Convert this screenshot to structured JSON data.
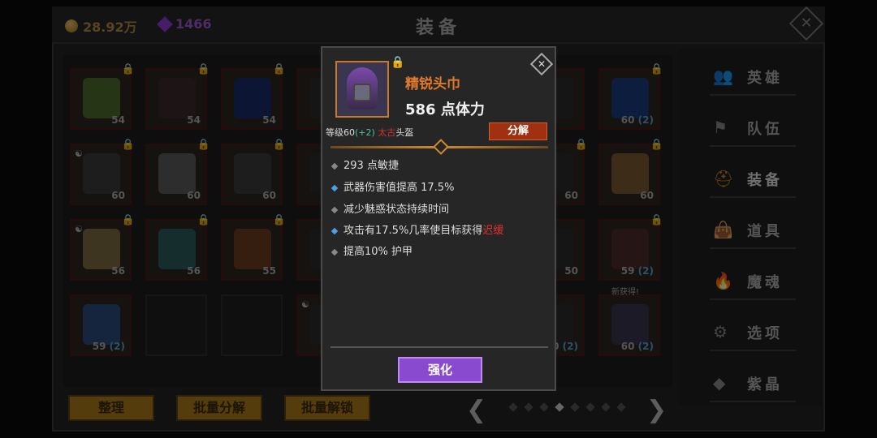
{
  "header": {
    "gold": "28.92万",
    "crystals": "1466",
    "title": "装备",
    "close_symbol": "✕"
  },
  "inventory": [
    {
      "level": "54",
      "locked": true,
      "icon": "spear-icon",
      "color": "#4a6a2a"
    },
    {
      "level": "54",
      "locked": true,
      "icon": "dark-helmet-icon",
      "color": "#3a2a2a"
    },
    {
      "level": "54",
      "locked": true,
      "icon": "blue-boots-icon",
      "color": "#1a2a6a"
    },
    {
      "level": "",
      "locked": true,
      "icon": "hidden-item-icon",
      "color": "#2a2a2a"
    },
    {
      "level": "",
      "locked": false,
      "icon": "hidden-item-icon",
      "color": "#2a2a2a"
    },
    {
      "level": "",
      "locked": false,
      "icon": "hidden-item-icon",
      "color": "#2a2a2a"
    },
    {
      "level": "",
      "locked": false,
      "icon": "hidden-item-icon",
      "color": "#2a2a2a"
    },
    {
      "level": "60",
      "bonus": "(2)",
      "locked": true,
      "icon": "blue-tome-icon",
      "color": "#1a3a7a"
    },
    {
      "level": "60",
      "locked": true,
      "yin": true,
      "icon": "hood-helmet-icon",
      "color": "#3a3a3a"
    },
    {
      "level": "60",
      "locked": true,
      "icon": "white-armor-icon",
      "color": "#5a5a5a"
    },
    {
      "level": "60",
      "locked": true,
      "icon": "dark-boots-icon",
      "color": "#3a3a3a"
    },
    {
      "level": "",
      "locked": false,
      "icon": "hidden-item-icon",
      "color": "#2a2a2a"
    },
    {
      "level": "",
      "locked": false,
      "icon": "hidden-item-icon",
      "color": "#2a2a2a"
    },
    {
      "level": "",
      "locked": false,
      "icon": "hidden-item-icon",
      "color": "#2a2a2a"
    },
    {
      "level": "60",
      "locked": true,
      "icon": "hidden-item-icon",
      "color": "#2a2a2a"
    },
    {
      "level": "60",
      "locked": true,
      "icon": "gold-armor-icon",
      "color": "#7a5a30"
    },
    {
      "level": "56",
      "locked": true,
      "yin": true,
      "icon": "gold-armor-icon",
      "color": "#7a6a40"
    },
    {
      "level": "56",
      "locked": true,
      "icon": "teal-boots-icon",
      "color": "#2a5a5a"
    },
    {
      "level": "55",
      "locked": true,
      "icon": "red-armor-icon",
      "color": "#6a3a20"
    },
    {
      "level": "",
      "locked": false,
      "icon": "hidden-item-icon",
      "color": "#2a2a2a"
    },
    {
      "level": "",
      "locked": false,
      "icon": "hidden-item-icon",
      "color": "#2a2a2a"
    },
    {
      "level": "",
      "locked": false,
      "icon": "hidden-item-icon",
      "color": "#2a2a2a"
    },
    {
      "level": "50",
      "locked": false,
      "icon": "hidden-item-icon",
      "color": "#2a2a2a"
    },
    {
      "level": "59",
      "bonus": "(2)",
      "locked": true,
      "icon": "red-boots-icon",
      "color": "#4a2a2a"
    },
    {
      "level": "59",
      "bonus": "(2)",
      "locked": false,
      "icon": "blue-tome-icon",
      "color": "#2a4a7a"
    },
    {
      "level": "",
      "locked": false,
      "empty": true
    },
    {
      "level": "",
      "locked": false,
      "empty": true
    },
    {
      "level": "",
      "locked": false,
      "yin": true,
      "icon": "hidden-item-icon",
      "color": "#2a2a2a"
    },
    {
      "level": "",
      "locked": false,
      "icon": "hidden-item-icon",
      "color": "#2a2a2a"
    },
    {
      "level": "",
      "locked": false,
      "icon": "hidden-item-icon",
      "color": "#2a2a2a"
    },
    {
      "level": "60",
      "bonus": "(2)",
      "locked": false,
      "newtag": "得!",
      "icon": "hidden-item-icon",
      "color": "#2a2a2a"
    },
    {
      "level": "60",
      "bonus": "(2)",
      "locked": false,
      "newtag": "新获得!",
      "icon": "dark-hood-icon",
      "color": "#3a3550"
    }
  ],
  "bottom_buttons": [
    "整理",
    "批量分解",
    "批量解锁"
  ],
  "pager": {
    "prev": "❮",
    "next": "❯",
    "pages": 8,
    "active": 3
  },
  "sidebar": [
    {
      "label": "英雄",
      "icon": "heroes-icon",
      "glyph": "👥",
      "active": false
    },
    {
      "label": "队伍",
      "icon": "team-flag-icon",
      "glyph": "⚑",
      "active": false
    },
    {
      "label": "装备",
      "icon": "helmet-icon",
      "glyph": "⛑",
      "active": true
    },
    {
      "label": "道具",
      "icon": "bag-icon",
      "glyph": "👜",
      "active": false
    },
    {
      "label": "魔魂",
      "icon": "flame-icon",
      "glyph": "🔥",
      "active": false
    },
    {
      "label": "选项",
      "icon": "gear-icon",
      "glyph": "⚙",
      "active": false
    },
    {
      "label": "紫晶",
      "icon": "crystal-icon",
      "glyph": "◆",
      "active": false
    }
  ],
  "popup": {
    "name": "精锐头巾",
    "main_stat": "586 点体力",
    "level_prefix": "等级60",
    "level_bonus": "(+2)",
    "quality": "太古",
    "item_type": "头盔",
    "dismantle_label": "分解",
    "close_symbol": "✕",
    "attributes": [
      {
        "text": "293 点敏捷",
        "bullet": "gray"
      },
      {
        "text": "武器伤害值提高 17.5%",
        "bullet": "blue"
      },
      {
        "text": "减少魅惑状态持续时间",
        "bullet": "gray"
      },
      {
        "text": "攻击有17.5%几率使目标获得",
        "highlight": "迟缓",
        "bullet": "blue"
      },
      {
        "text": "提高10% 护甲",
        "bullet": "gray"
      }
    ],
    "enhance_label": "强化"
  }
}
